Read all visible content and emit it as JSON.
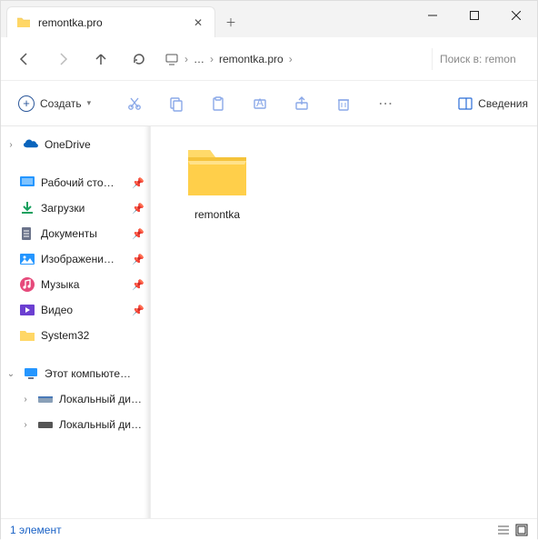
{
  "window": {
    "title": "remontka.pro"
  },
  "nav": {
    "breadcrumb_current": "remontka.pro",
    "search_placeholder": "Поиск в: remon"
  },
  "toolbar": {
    "create_label": "Создать",
    "details_label": "Сведения"
  },
  "sidebar": {
    "onedrive": "OneDrive",
    "quick": {
      "desktop": "Рабочий сто…",
      "downloads": "Загрузки",
      "documents": "Документы",
      "pictures": "Изображени…",
      "music": "Музыка",
      "videos": "Видео",
      "system32": "System32"
    },
    "thispc": "Этот компьюте…",
    "drive_c": "Локальный ди…",
    "drive_d": "Локальный ди…"
  },
  "content": {
    "items": [
      {
        "name": "remontka"
      }
    ]
  },
  "status": {
    "text": "1 элемент"
  }
}
